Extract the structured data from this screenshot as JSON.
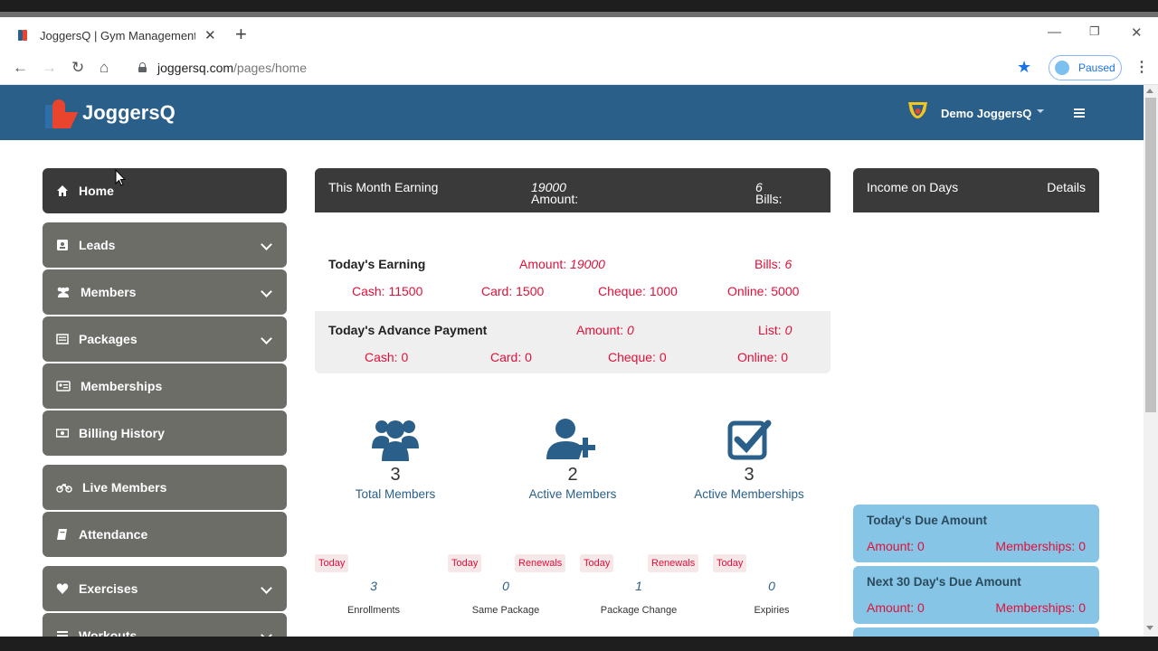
{
  "browser": {
    "tab_title": "JoggersQ | Gym Management Sc",
    "url_host": "joggersq.com",
    "url_path": "/pages/home",
    "profile_status": "Paused"
  },
  "header": {
    "brand": "JoggersQ",
    "user_name": "Demo JoggersQ"
  },
  "sidebar": {
    "items": [
      {
        "label": "Home",
        "icon": "home-icon"
      },
      {
        "label": "Leads",
        "icon": "address-book-icon"
      },
      {
        "label": "Members",
        "icon": "users-icon"
      },
      {
        "label": "Packages",
        "icon": "list-icon"
      },
      {
        "label": "Memberships",
        "icon": "id-card-icon"
      },
      {
        "label": "Billing History",
        "icon": "money-bill-icon"
      },
      {
        "label": "Live Members",
        "icon": "bicycle-icon"
      },
      {
        "label": "Attendance",
        "icon": "book-icon"
      },
      {
        "label": "Exercises",
        "icon": "heart-icon"
      },
      {
        "label": "Workouts",
        "icon": "bars-icon"
      }
    ]
  },
  "earning": {
    "title": "This Month Earning",
    "amount_label": "Amount:",
    "amount_value": "19000",
    "bills_label": "Bills:",
    "bills_value": "6",
    "today": {
      "title": "Today's Earning",
      "amount_label": "Amount:",
      "amount_value": "19000",
      "bills_label": "Bills:",
      "bills_value": "6",
      "cash": "Cash: 11500",
      "card": "Card: 1500",
      "cheque": "Cheque: 1000",
      "online": "Online: 5000"
    },
    "advance": {
      "title": "Today's Advance Payment",
      "amount_label": "Amount:",
      "amount_value": "0",
      "list_label": "List:",
      "list_value": "0",
      "cash": "Cash: 0",
      "card": "Card: 0",
      "cheque": "Cheque: 0",
      "online": "Online: 0"
    }
  },
  "stats": [
    {
      "value": "3",
      "label": "Total Members",
      "icon": "users-icon"
    },
    {
      "value": "2",
      "label": "Active Members",
      "icon": "user-plus-icon"
    },
    {
      "value": "3",
      "label": "Active Memberships",
      "icon": "check-square-icon"
    }
  ],
  "counters": [
    {
      "tags": [
        "Today"
      ],
      "value": "3",
      "label": "Enrollments"
    },
    {
      "tags": [
        "Today",
        "Renewals"
      ],
      "value": "0",
      "label": "Same Package"
    },
    {
      "tags": [
        "Today",
        "Renewals"
      ],
      "value": "1",
      "label": "Package Change"
    },
    {
      "tags": [
        "Today"
      ],
      "value": "0",
      "label": "Expiries"
    }
  ],
  "income": {
    "title": "Income on Days",
    "details_label": "Details"
  },
  "due": [
    {
      "title": "Today's Due Amount",
      "amount": "Amount: 0",
      "memberships": "Memberships: 0"
    },
    {
      "title": "Next 30 Day's Due Amount",
      "amount": "Amount: 0",
      "memberships": "Memberships: 0"
    }
  ],
  "colors": {
    "header_blue": "#2a5f8a",
    "sidebar_gray": "#6d6d68",
    "dark_panel": "#3a3a3a",
    "accent_red": "#e0103a",
    "due_blue": "#86c5e6"
  }
}
